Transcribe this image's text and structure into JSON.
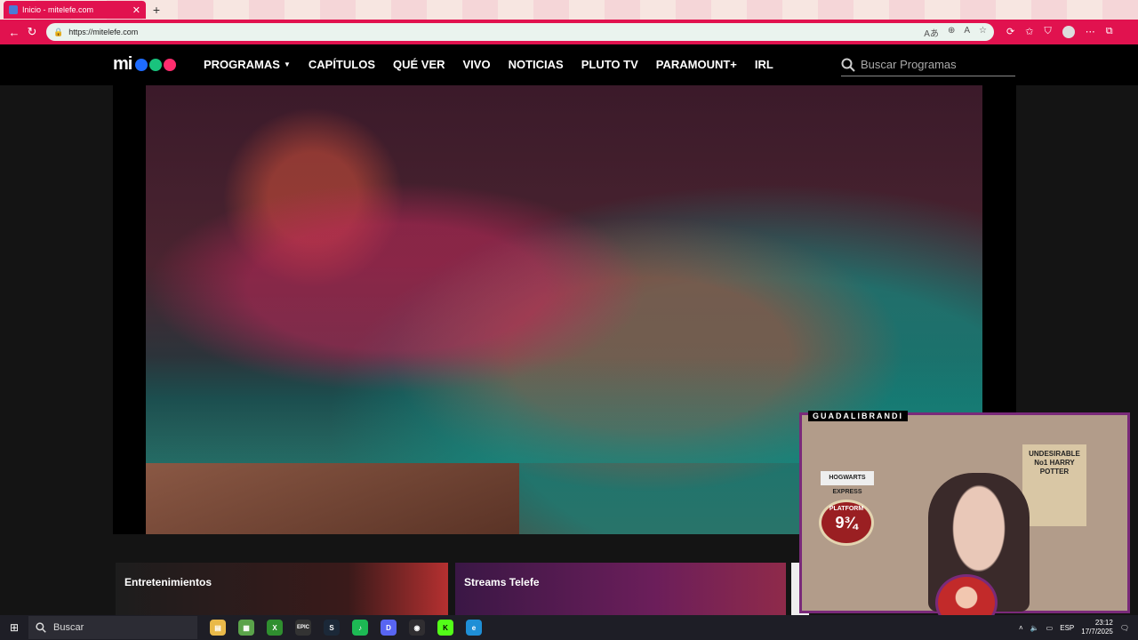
{
  "browser": {
    "tab_title": "Inicio - mitelefe.com",
    "close_glyph": "✕",
    "newtab_glyph": "+",
    "url": "https://mitelefe.com",
    "back_glyph": "←",
    "refresh_glyph": "↻",
    "url_icons": [
      "Aあ",
      "⊕",
      "A",
      "☆"
    ],
    "toolbar_icons": [
      "⟳",
      "✩",
      "⛉",
      "⋯",
      "⧉"
    ]
  },
  "site": {
    "logo_text": "mi",
    "logo_colors": [
      "#1e6cff",
      "#19c37d",
      "#ff2d6e"
    ],
    "nav": {
      "programas": "PROGRAMAS",
      "capitulos": "CAPÍTULOS",
      "que_ver": "QUÉ VER",
      "vivo": "VIVO",
      "noticias": "NOTICIAS",
      "pluto_tv": "PLUTO TV",
      "paramount": "PARAMOUNT+",
      "irl": "IRL"
    },
    "search_placeholder": "Buscar Programas",
    "sections": {
      "entretenimientos": "Entretenimientos",
      "streams": "Streams Telefe"
    }
  },
  "stream_overlay": {
    "title": "GUADALIBRANDI",
    "poster_text": "UNDESIRABLE No1 HARRY POTTER",
    "platform_label": "PLATFORM",
    "platform_number": "9¾",
    "sign_text": "HOGWARTS EXPRESS"
  },
  "taskbar": {
    "search_label": "Buscar",
    "apps": [
      {
        "name": "file-explorer",
        "color": "#e9b949",
        "glyph": "▤"
      },
      {
        "name": "minecraft",
        "color": "#5aa34a",
        "glyph": "▦"
      },
      {
        "name": "xbox",
        "color": "#2f8f2f",
        "glyph": "X"
      },
      {
        "name": "epic-games",
        "color": "#333333",
        "glyph": "EPIC"
      },
      {
        "name": "steam",
        "color": "#1b2838",
        "glyph": "S"
      },
      {
        "name": "spotify",
        "color": "#1db954",
        "glyph": "♪"
      },
      {
        "name": "discord",
        "color": "#5865f2",
        "glyph": "D"
      },
      {
        "name": "obs",
        "color": "#302e31",
        "glyph": "◉"
      },
      {
        "name": "kick",
        "color": "#53fc18",
        "glyph": "K"
      },
      {
        "name": "edge",
        "color": "#1f8fd6",
        "glyph": "e"
      }
    ],
    "lang": "ESP",
    "time": "23:12",
    "date": "17/7/2025"
  }
}
